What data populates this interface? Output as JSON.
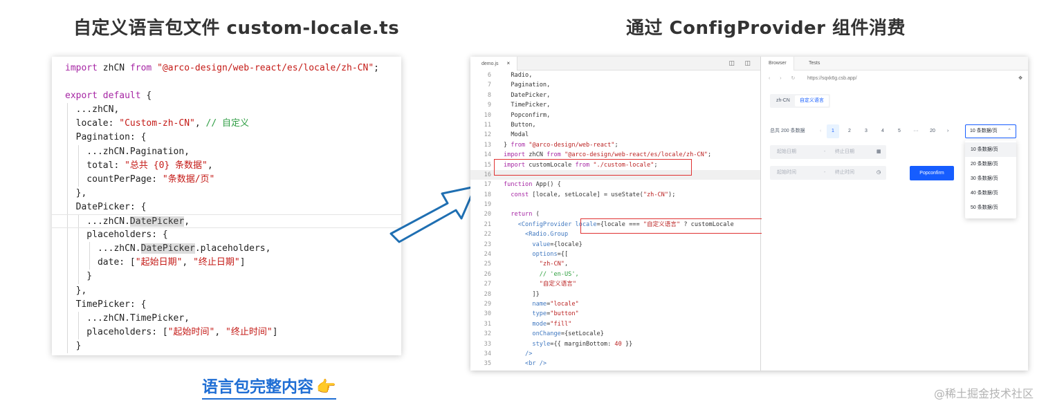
{
  "headings": {
    "left": "自定义语言包文件 custom-locale.ts",
    "right": "通过 ConfigProvider 组件消费"
  },
  "left_code": {
    "lines": [
      [
        {
          "t": "import",
          "c": "k"
        },
        {
          "t": " zhCN ",
          "c": "p"
        },
        {
          "t": "from",
          "c": "k"
        },
        {
          "t": " ",
          "c": "p"
        },
        {
          "t": "\"@arco-design/web-react/es/locale/zh-CN\"",
          "c": "s"
        },
        {
          "t": ";",
          "c": "p"
        }
      ],
      [],
      [
        {
          "t": "export",
          "c": "k"
        },
        {
          "t": " ",
          "c": "p"
        },
        {
          "t": "default",
          "c": "k"
        },
        {
          "t": " {",
          "c": "p"
        }
      ],
      [
        {
          "t": "  ...zhCN,",
          "c": "p"
        }
      ],
      [
        {
          "t": "  locale: ",
          "c": "p"
        },
        {
          "t": "\"Custom-zh-CN\"",
          "c": "s"
        },
        {
          "t": ", ",
          "c": "p"
        },
        {
          "t": "// 自定义",
          "c": "c"
        }
      ],
      [
        {
          "t": "  Pagination: {",
          "c": "p"
        }
      ],
      [
        {
          "t": "    ...zhCN.Pagination,",
          "c": "p"
        }
      ],
      [
        {
          "t": "    total: ",
          "c": "p"
        },
        {
          "t": "\"总共 {0} 条数据\"",
          "c": "s"
        },
        {
          "t": ",",
          "c": "p"
        }
      ],
      [
        {
          "t": "    countPerPage: ",
          "c": "p"
        },
        {
          "t": "\"条数据/页\"",
          "c": "s"
        }
      ],
      [
        {
          "t": "  },",
          "c": "p"
        }
      ],
      [
        {
          "t": "  DatePicker: {",
          "c": "p"
        }
      ],
      [
        {
          "t": "    ...zhCN.",
          "c": "p"
        },
        {
          "t": "DatePicker",
          "c": "sel"
        },
        {
          "t": ",",
          "c": "p"
        }
      ],
      [
        {
          "t": "    placeholders: {",
          "c": "p"
        }
      ],
      [
        {
          "t": "      ...zhCN.",
          "c": "p"
        },
        {
          "t": "DatePicker",
          "c": "sel"
        },
        {
          "t": ".placeholders,",
          "c": "p"
        }
      ],
      [
        {
          "t": "      date: [",
          "c": "p"
        },
        {
          "t": "\"起始日期\"",
          "c": "s"
        },
        {
          "t": ", ",
          "c": "p"
        },
        {
          "t": "\"终止日期\"",
          "c": "s"
        },
        {
          "t": "]",
          "c": "p"
        }
      ],
      [
        {
          "t": "    }",
          "c": "p"
        }
      ],
      [
        {
          "t": "  },",
          "c": "p"
        }
      ],
      [
        {
          "t": "  TimePicker: {",
          "c": "p"
        }
      ],
      [
        {
          "t": "    ...zhCN.TimePicker,",
          "c": "p"
        }
      ],
      [
        {
          "t": "    placeholders: [",
          "c": "p"
        },
        {
          "t": "\"起始时间\"",
          "c": "s"
        },
        {
          "t": ", ",
          "c": "p"
        },
        {
          "t": "\"终止时间\"",
          "c": "s"
        },
        {
          "t": "]",
          "c": "p"
        }
      ],
      [
        {
          "t": "  }",
          "c": "p"
        }
      ]
    ]
  },
  "link_caption": "语言包完整内容",
  "hand_icon": "👉",
  "ide": {
    "tab_label": "demo.js",
    "tab_close": "×",
    "lines": [
      {
        "n": "6",
        "t": [
          {
            "t": "  Radio,",
            "c": ""
          }
        ]
      },
      {
        "n": "7",
        "t": [
          {
            "t": "  Pagination,",
            "c": ""
          }
        ]
      },
      {
        "n": "8",
        "t": [
          {
            "t": "  DatePicker,",
            "c": ""
          }
        ]
      },
      {
        "n": "9",
        "t": [
          {
            "t": "  TimePicker,",
            "c": ""
          }
        ]
      },
      {
        "n": "10",
        "t": [
          {
            "t": "  Popconfirm,",
            "c": ""
          }
        ]
      },
      {
        "n": "11",
        "t": [
          {
            "t": "  Button,",
            "c": ""
          }
        ]
      },
      {
        "n": "12",
        "t": [
          {
            "t": "  Modal",
            "c": ""
          }
        ]
      },
      {
        "n": "13",
        "t": [
          {
            "t": "} ",
            "c": ""
          },
          {
            "t": "from",
            "c": "ek"
          },
          {
            "t": " ",
            "c": ""
          },
          {
            "t": "\"@arco-design/web-react\"",
            "c": "es"
          },
          {
            "t": ";",
            "c": ""
          }
        ]
      },
      {
        "n": "14",
        "t": [
          {
            "t": "import",
            "c": "ek"
          },
          {
            "t": " zhCN ",
            "c": ""
          },
          {
            "t": "from",
            "c": "ek"
          },
          {
            "t": " ",
            "c": ""
          },
          {
            "t": "\"@arco-design/web-react/es/locale/zh-CN\"",
            "c": "es"
          },
          {
            "t": ";",
            "c": ""
          }
        ]
      },
      {
        "n": "15",
        "t": [
          {
            "t": "import",
            "c": "ek"
          },
          {
            "t": " customLocale ",
            "c": ""
          },
          {
            "t": "from",
            "c": "ek"
          },
          {
            "t": " ",
            "c": ""
          },
          {
            "t": "\"./custom-locale\"",
            "c": "es"
          },
          {
            "t": ";",
            "c": ""
          }
        ]
      },
      {
        "n": "16",
        "t": []
      },
      {
        "n": "17",
        "t": [
          {
            "t": "function",
            "c": "ek"
          },
          {
            "t": " App() {",
            "c": ""
          }
        ]
      },
      {
        "n": "18",
        "t": [
          {
            "t": "  ",
            "c": ""
          },
          {
            "t": "const",
            "c": "ek"
          },
          {
            "t": " [locale, setLocale] = useState(",
            "c": ""
          },
          {
            "t": "\"zh-CN\"",
            "c": "es"
          },
          {
            "t": ");",
            "c": ""
          }
        ]
      },
      {
        "n": "19",
        "t": []
      },
      {
        "n": "20",
        "t": [
          {
            "t": "  ",
            "c": ""
          },
          {
            "t": "return",
            "c": "ek"
          },
          {
            "t": " (",
            "c": ""
          }
        ]
      },
      {
        "n": "21",
        "t": [
          {
            "t": "    ",
            "c": ""
          },
          {
            "t": "<ConfigProvider",
            "c": "et"
          },
          {
            "t": " ",
            "c": ""
          },
          {
            "t": "locale",
            "c": "et"
          },
          {
            "t": "={locale === ",
            "c": ""
          },
          {
            "t": "\"自定义语言\"",
            "c": "es"
          },
          {
            "t": " ? customLocale",
            "c": ""
          }
        ]
      },
      {
        "n": "22",
        "t": [
          {
            "t": "      ",
            "c": ""
          },
          {
            "t": "<Radio.Group",
            "c": "et"
          }
        ]
      },
      {
        "n": "23",
        "t": [
          {
            "t": "        ",
            "c": ""
          },
          {
            "t": "value",
            "c": "et"
          },
          {
            "t": "={locale}",
            "c": ""
          }
        ]
      },
      {
        "n": "24",
        "t": [
          {
            "t": "        ",
            "c": ""
          },
          {
            "t": "options",
            "c": "et"
          },
          {
            "t": "={[",
            "c": ""
          }
        ]
      },
      {
        "n": "25",
        "t": [
          {
            "t": "          ",
            "c": ""
          },
          {
            "t": "\"zh-CN\"",
            "c": "es"
          },
          {
            "t": ",",
            "c": ""
          }
        ]
      },
      {
        "n": "26",
        "t": [
          {
            "t": "          ",
            "c": ""
          },
          {
            "t": "// 'en-US',",
            "c": "ec"
          }
        ]
      },
      {
        "n": "27",
        "t": [
          {
            "t": "          ",
            "c": ""
          },
          {
            "t": "\"自定义语言\"",
            "c": "es"
          }
        ]
      },
      {
        "n": "28",
        "t": [
          {
            "t": "        ]}",
            "c": ""
          }
        ]
      },
      {
        "n": "29",
        "t": [
          {
            "t": "        ",
            "c": ""
          },
          {
            "t": "name",
            "c": "et"
          },
          {
            "t": "=",
            "c": ""
          },
          {
            "t": "\"locale\"",
            "c": "es"
          }
        ]
      },
      {
        "n": "30",
        "t": [
          {
            "t": "        ",
            "c": ""
          },
          {
            "t": "type",
            "c": "et"
          },
          {
            "t": "=",
            "c": ""
          },
          {
            "t": "\"button\"",
            "c": "es"
          }
        ]
      },
      {
        "n": "31",
        "t": [
          {
            "t": "        ",
            "c": ""
          },
          {
            "t": "mode",
            "c": "et"
          },
          {
            "t": "=",
            "c": ""
          },
          {
            "t": "\"fill\"",
            "c": "es"
          }
        ]
      },
      {
        "n": "32",
        "t": [
          {
            "t": "        ",
            "c": ""
          },
          {
            "t": "onChange",
            "c": "et"
          },
          {
            "t": "={setLocale}",
            "c": ""
          }
        ]
      },
      {
        "n": "33",
        "t": [
          {
            "t": "        ",
            "c": ""
          },
          {
            "t": "style",
            "c": "et"
          },
          {
            "t": "={{ marginBottom: ",
            "c": ""
          },
          {
            "t": "40",
            "c": "es"
          },
          {
            "t": " }}",
            "c": ""
          }
        ]
      },
      {
        "n": "34",
        "t": [
          {
            "t": "      />",
            "c": "et"
          }
        ]
      },
      {
        "n": "35",
        "t": [
          {
            "t": "      ",
            "c": ""
          },
          {
            "t": "<br />",
            "c": "et"
          }
        ]
      }
    ]
  },
  "browser": {
    "tabs": [
      "Browser",
      "Tests"
    ],
    "url": "https://sqxk6g.csb.app/",
    "radio_options": [
      "zh-CN",
      "自定义语言"
    ],
    "pagination": {
      "total_text": "总共 200 条数据",
      "prev": "‹",
      "pages": [
        "1",
        "2",
        "3",
        "4",
        "5",
        "···",
        "20"
      ],
      "next": "›",
      "size_selected": "10 条数据/页",
      "size_options": [
        "10 条数据/页",
        "20 条数据/页",
        "30 条数据/页",
        "40 条数据/页",
        "50 条数据/页"
      ]
    },
    "date_picker": {
      "start": "起始日期",
      "sep": "-",
      "end": "终止日期"
    },
    "time_picker": {
      "start": "起始时间",
      "sep": "-",
      "end": "终止时间"
    },
    "popconfirm_label": "Popconfirm"
  },
  "watermark": "@稀土掘金技术社区"
}
